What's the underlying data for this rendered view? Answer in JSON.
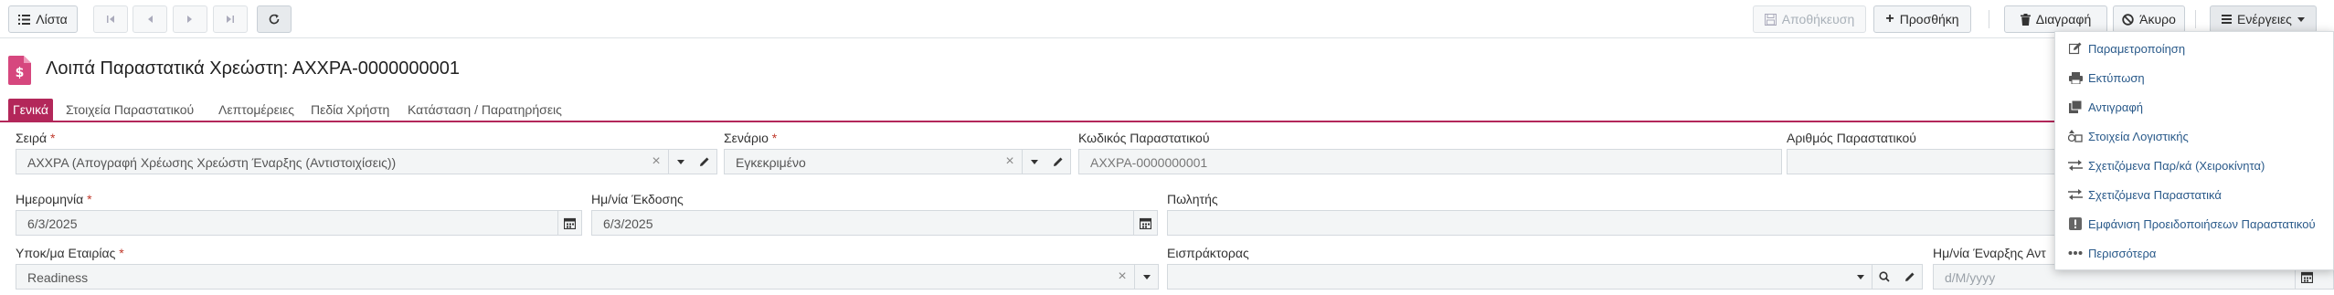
{
  "toolbar": {
    "list_label": "Λίστα",
    "save_label": "Αποθήκευση",
    "add_label": "Προσθήκη",
    "delete_label": "Διαγραφή",
    "cancel_label": "Άκυρο",
    "actions_label": "Ενέργειες"
  },
  "page": {
    "title": "Λοιπά Παραστατικά Χρεώστη: ΑΧΧΡΑ-0000000001"
  },
  "tabs": [
    {
      "label": "Γενικά",
      "active": true
    },
    {
      "label": "Στοιχεία Παραστατικού"
    },
    {
      "label": "Λεπτομέρειες"
    },
    {
      "label": "Πεδία Χρήστη"
    },
    {
      "label": "Κατάσταση / Παρατηρήσεις"
    }
  ],
  "form": {
    "series": {
      "label": "Σειρά",
      "required": "*",
      "value": "ΑΧΧΡΑ (Απογραφή Χρέωσης Χρεώστη Έναρξης (Αντιστοιχίσεις))"
    },
    "scenario": {
      "label": "Σενάριο",
      "required": "*",
      "value": "Εγκεκριμένο"
    },
    "doc_code": {
      "label": "Κωδικός Παραστατικού",
      "value": "ΑΧΧΡΑ-0000000001"
    },
    "doc_number": {
      "label": "Αριθμός Παραστατικού",
      "value": ""
    },
    "date": {
      "label": "Ημερομηνία",
      "required": "*",
      "value": "6/3/2025"
    },
    "issue_date": {
      "label": "Ημ/νία Έκδοσης",
      "value": "6/3/2025"
    },
    "seller": {
      "label": "Πωλητής",
      "value": ""
    },
    "branch": {
      "label": "Υποκ/μα Εταιρίας",
      "required": "*",
      "value": "Readiness"
    },
    "collector": {
      "label": "Εισπράκτορας",
      "value": ""
    },
    "start_date": {
      "label": "Ημ/νία Έναρξης Αντ",
      "placeholder": "d/M/yyyy"
    }
  },
  "actions_menu": [
    {
      "label": "Παραμετροποίηση",
      "icon": "edit-icon"
    },
    {
      "label": "Εκτύπωση",
      "icon": "printer-icon"
    },
    {
      "label": "Αντιγραφή",
      "icon": "copy-icon"
    },
    {
      "label": "Στοιχεία Λογιστικής",
      "icon": "accounting-icon"
    },
    {
      "label": "Σχετιζόμενα Παρ/κά (Χειροκίνητα)",
      "icon": "exchange-icon"
    },
    {
      "label": "Σχετιζόμενα Παραστατικά",
      "icon": "exchange-icon"
    },
    {
      "label": "Εμφάνιση Προειδοποιήσεων Παραστατικού",
      "icon": "warning-icon"
    },
    {
      "label": "Περισσότερα",
      "icon": "more-icon"
    }
  ],
  "colors": {
    "accent": "#b3275a",
    "link": "#2a5a8a"
  }
}
